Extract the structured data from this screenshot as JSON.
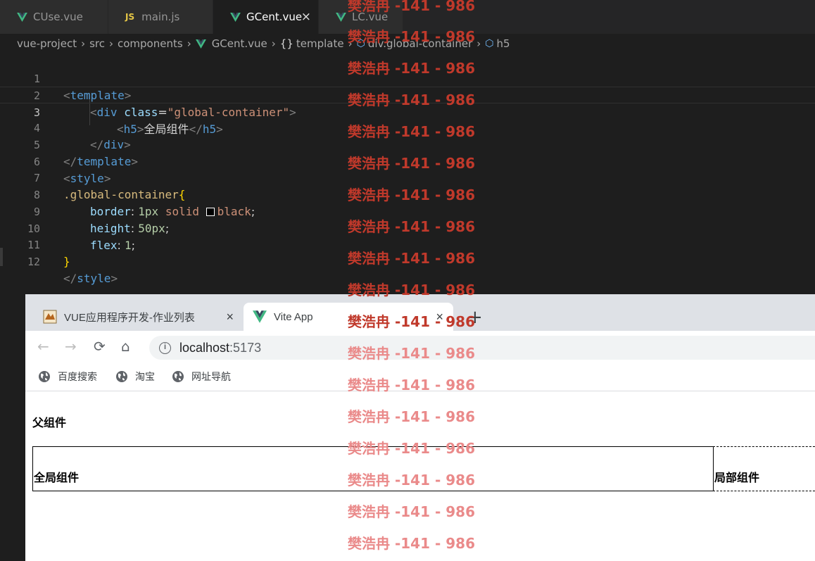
{
  "editor_tabs": [
    {
      "label": "CUse.vue",
      "icon": "vue-icon",
      "active": false
    },
    {
      "label": "main.js",
      "icon": "js-icon",
      "active": false
    },
    {
      "label": "GCent.vue",
      "icon": "vue-icon",
      "active": true,
      "close": "×"
    },
    {
      "label": "LC.vue",
      "icon": "vue-icon",
      "active": false
    }
  ],
  "js_badge": "JS",
  "breadcrumb": {
    "items": [
      "vue-project",
      "src",
      "components",
      "GCent.vue",
      "template",
      "div.global-container",
      "h5"
    ],
    "separator": "›",
    "brace": "{}"
  },
  "code": {
    "line_numbers": [
      "1",
      "2",
      "3",
      "4",
      "5",
      "6",
      "7",
      "8",
      "9",
      "10",
      "11",
      "12"
    ],
    "current_line": 3,
    "l1": {
      "open": "<",
      "tag": "template",
      "close": ">"
    },
    "l2": {
      "open": "<",
      "tag": "div",
      "attr": "class",
      "eq": "=",
      "val": "\"global-container\"",
      "close": ">"
    },
    "l3": {
      "open": "<",
      "tag": "h5",
      "close": ">",
      "text": "全局组件",
      "end_open": "</",
      "end_tag": "h5",
      "end_close": ">"
    },
    "l4": {
      "open": "</",
      "tag": "div",
      "close": ">"
    },
    "l5": {
      "open": "</",
      "tag": "template",
      "close": ">"
    },
    "l6": {
      "open": "<",
      "tag": "style",
      "close": ">"
    },
    "l7": {
      "selector": ".global-container",
      "brace": "{"
    },
    "l8": {
      "prop": "border",
      "colon": ": ",
      "num": "1px",
      "kw": "solid",
      "color": "black",
      "semi": ";"
    },
    "l9": {
      "prop": "height",
      "colon": ": ",
      "num": "50px",
      "semi": ";"
    },
    "l10": {
      "prop": "flex",
      "colon": ": ",
      "num": "1",
      "semi": ";"
    },
    "l11": {
      "brace": "}"
    },
    "l12": {
      "open": "</",
      "tag": "style",
      "close": ">"
    }
  },
  "browser": {
    "tabs": [
      {
        "label": "VUE应用程序开发-作业列表",
        "close": "×"
      },
      {
        "label": "Vite App",
        "close": "×"
      }
    ],
    "new_tab": "+",
    "nav": {
      "back": "←",
      "forward": "→",
      "reload": "⟳",
      "home": "⌂"
    },
    "url_host": "localhost",
    "url_port": ":5173",
    "info": "i",
    "bookmarks": [
      "百度搜索",
      "淘宝",
      "网址导航"
    ],
    "page": {
      "parent_title": "父组件",
      "global_component": "全局组件",
      "local_component": "局部组件"
    }
  },
  "watermark": "樊浩冉 -141 - 986"
}
